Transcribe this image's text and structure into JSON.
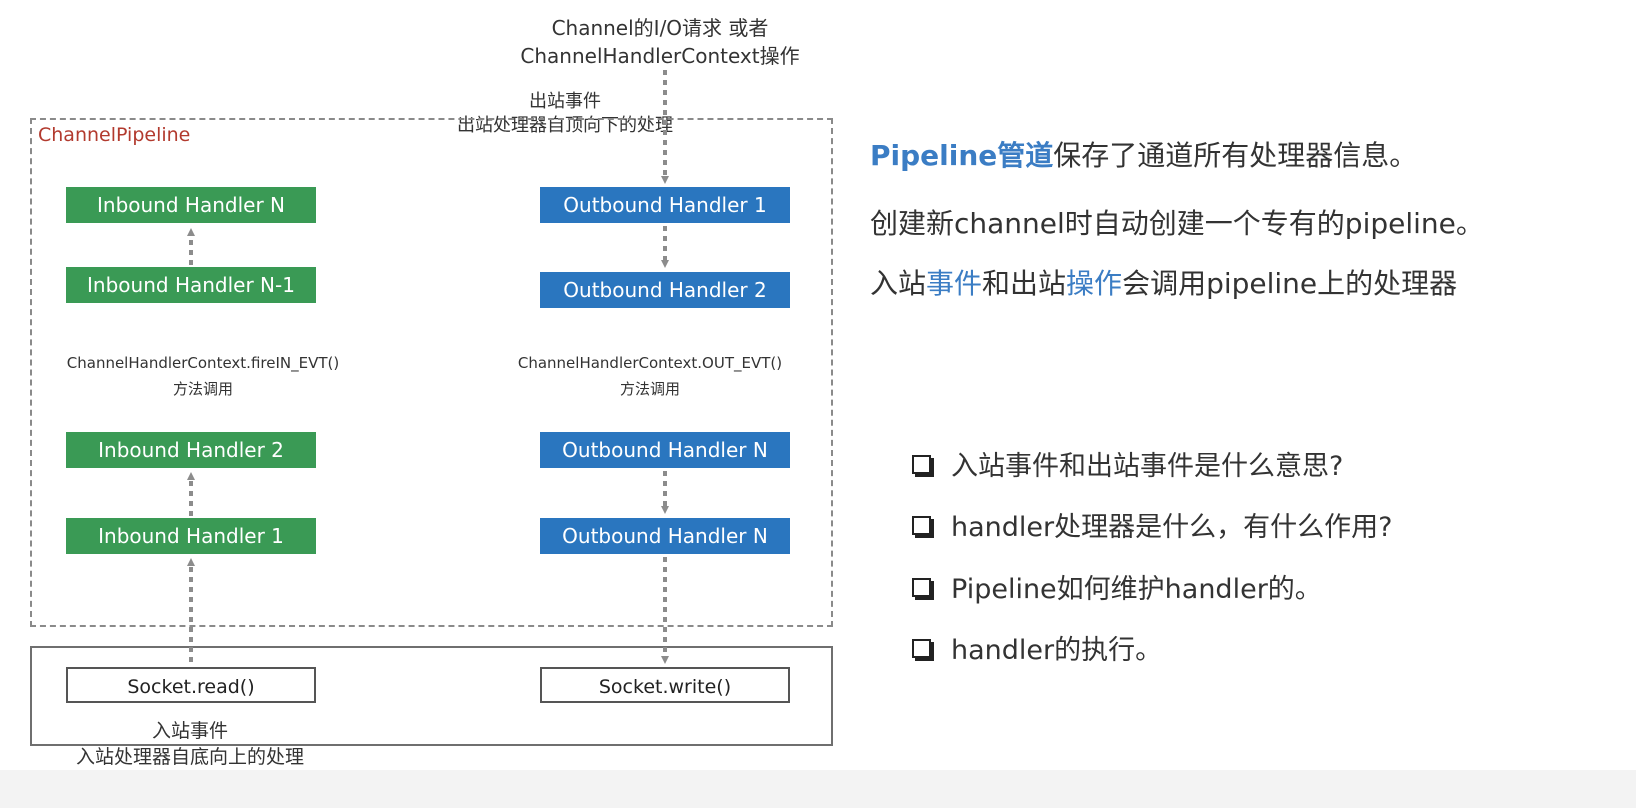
{
  "top_caption": {
    "line1": "Channel的I/O请求 或者",
    "line2": "ChannelHandlerContext操作"
  },
  "outbound_event": {
    "line1": "出站事件",
    "line2": "出站处理器自顶向下的处理"
  },
  "pipeline_label": "ChannelPipeline",
  "inbound_handlers": {
    "n": "Inbound Handler N",
    "n_minus_1": "Inbound Handler N-1",
    "h2": "Inbound Handler 2",
    "h1": "Inbound Handler 1"
  },
  "outbound_handlers": {
    "h1": "Outbound Handler 1",
    "h2": "Outbound Handler 2",
    "n_a": "Outbound Handler N",
    "n_b": "Outbound Handler N"
  },
  "inbound_method": {
    "line1": "ChannelHandlerContext.fireIN_EVT()",
    "line2": "方法调用"
  },
  "outbound_method": {
    "line1": "ChannelHandlerContext.OUT_EVT()",
    "line2": "方法调用"
  },
  "socket": {
    "read": "Socket.read()",
    "write": "Socket.write()"
  },
  "inbound_event": {
    "line1": "入站事件",
    "line2": "入站处理器自底向上的处理"
  },
  "description": {
    "line1_highlight": "Pipeline管道",
    "line1_rest": "保存了通道所有处理器信息。",
    "line2": "创建新channel时自动创建一个专有的pipeline。",
    "line3_part1": "入站",
    "line3_highlight1": "事件",
    "line3_part2": "和出站",
    "line3_highlight2": "操作",
    "line3_part3": "会调用pipeline上的处理器"
  },
  "questions": [
    "入站事件和出站事件是什么意思?",
    "handler处理器是什么，有什么作用?",
    "Pipeline如何维护handler的。",
    "handler的执行。"
  ],
  "colors": {
    "inbound": "#3a9a55",
    "outbound": "#2a76bf",
    "accent": "#3b7dc4",
    "pipeline_label": "#b23a2e"
  }
}
